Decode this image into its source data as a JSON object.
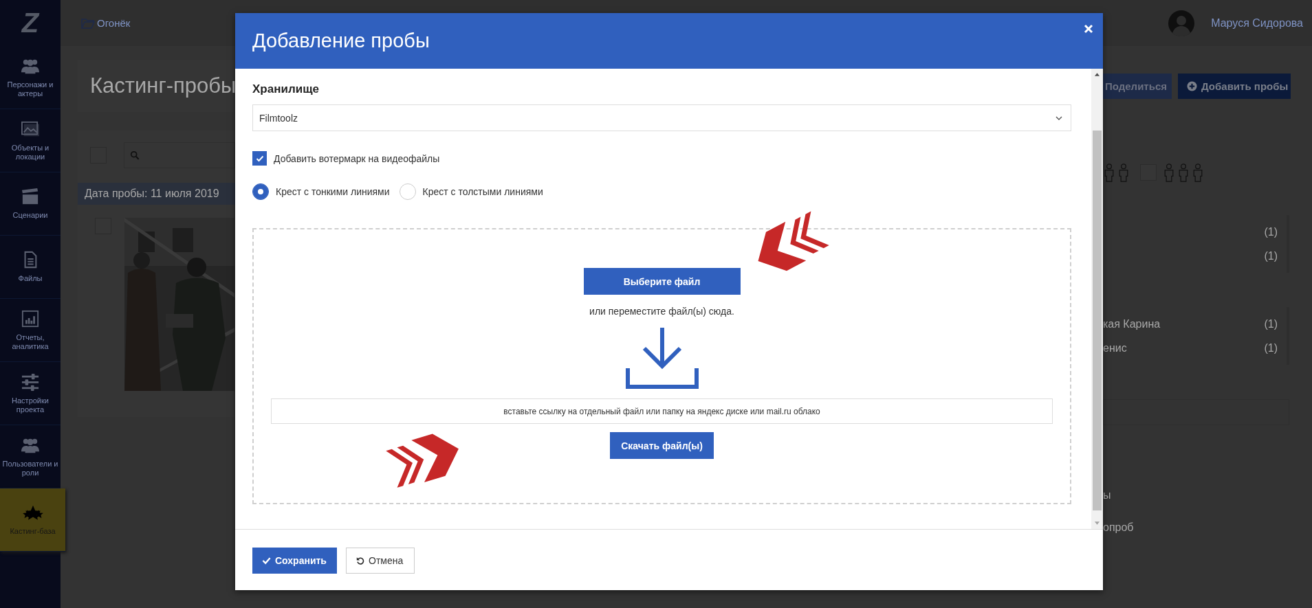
{
  "sidebar": {
    "logo": "Z",
    "items": [
      {
        "label": "Персонажи и актеры",
        "selected": false
      },
      {
        "label": "Объекты и локации",
        "selected": false
      },
      {
        "label": "Сценарии",
        "selected": false
      },
      {
        "label": "Файлы",
        "selected": false
      },
      {
        "label": "Отчеты, аналитика",
        "selected": false
      },
      {
        "label": "Настройки проекта",
        "selected": false
      },
      {
        "label": "Пользователи и роли",
        "selected": false
      },
      {
        "label": "Кастинг-база",
        "selected": true
      }
    ]
  },
  "topbar": {
    "breadcrumb": "Огонёк",
    "user_name": "Маруся Сидорова"
  },
  "page": {
    "title": "Кастинг-пробы",
    "actions": [
      "Поделиться",
      "Добавить пробы"
    ],
    "select_all": {
      "checked": false
    },
    "shots": [
      {
        "date": "Дата пробы: 11 июля 2019"
      }
    ],
    "group_filter": {
      "checked": false
    },
    "name_lists": [
      {
        "rows": [
          {
            "count": "(1)"
          },
          {
            "count": "(1)"
          }
        ]
      },
      {
        "rows": [
          {
            "label": "кая Карина",
            "count": "(1)"
          },
          {
            "label": "енис",
            "count": "(1)"
          }
        ]
      }
    ],
    "links": [
      "ы",
      "опроб"
    ]
  },
  "modal": {
    "title": "Добавление пробы",
    "storage_label": "Хранилище",
    "storage_value": "Filmtoolz",
    "watermark": {
      "label": "Добавить вотермарк на видеофайлы",
      "checked": true
    },
    "cross_options": [
      {
        "label": "Крест с тонкими линиями",
        "selected": true
      },
      {
        "label": "Крест с толстыми линиями",
        "selected": false
      }
    ],
    "upload": {
      "choose_button": "Выберите файл",
      "drop_hint": "или переместите файл(ы) сюда.",
      "link_placeholder": "вставьте ссылку на отдельный файл или папку на яндекс диске или mail.ru облако",
      "download_button": "Скачать файл(ы)"
    },
    "buttons": [
      {
        "label": "Сохранить",
        "kind": "primary"
      },
      {
        "label": "Отмена",
        "kind": "secondary"
      }
    ]
  }
}
